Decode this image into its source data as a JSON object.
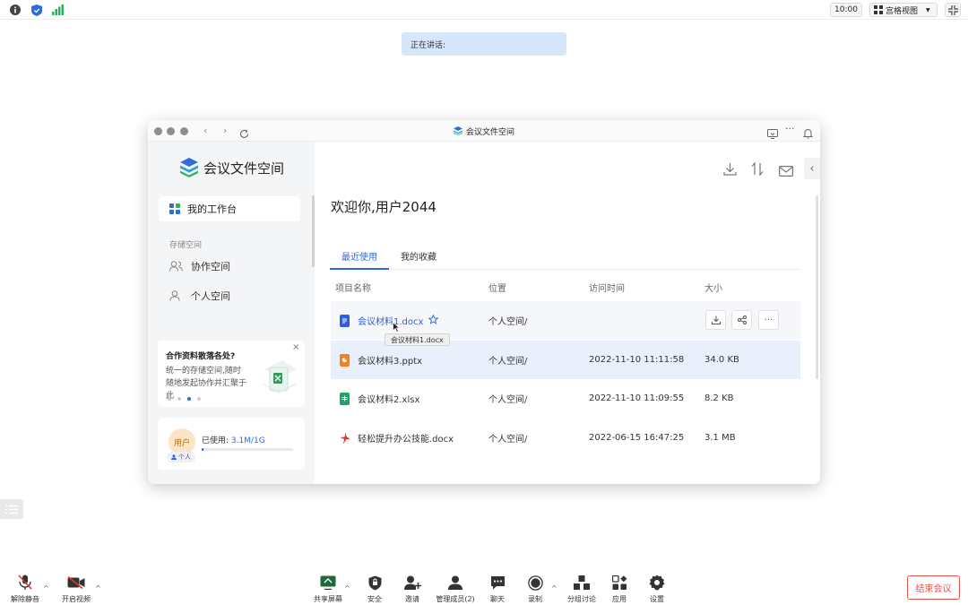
{
  "topbar": {
    "clock": "10:00",
    "view_label": "宫格视图"
  },
  "speaking_label": "正在讲话:",
  "window": {
    "title": "会议文件空间"
  },
  "sidebar": {
    "brand": "会议文件空间",
    "home": "我的工作台",
    "storage_label": "存储空间",
    "items": [
      {
        "label": "协作空间"
      },
      {
        "label": "个人空间"
      }
    ],
    "promo": {
      "title": "合作资料散落各处?",
      "text": "统一的存储空间,随时随地发起协作并汇聚于此",
      "close": "×"
    },
    "usage": {
      "avatar": "用户",
      "badge": "个人",
      "label": "已使用:",
      "value": "3.1M/1G",
      "fraction": 0.003
    }
  },
  "main": {
    "welcome": "欢迎你,用户2044",
    "tabs": [
      {
        "label": "最近使用"
      },
      {
        "label": "我的收藏"
      }
    ],
    "columns": {
      "name": "项目名称",
      "location": "位置",
      "time": "访问时间",
      "size": "大小"
    },
    "files": [
      {
        "name": "会议材料1.docx",
        "location": "个人空间/",
        "time": "",
        "size": "",
        "type": "doc",
        "color": "#2f5fde"
      },
      {
        "name": "会议材料3.pptx",
        "location": "个人空间/",
        "time": "2022-11-10 11:11:58",
        "size": "34.0 KB",
        "type": "ppt",
        "color": "#f0821d"
      },
      {
        "name": "会议材料2.xlsx",
        "location": "个人空间/",
        "time": "2022-11-10 11:09:55",
        "size": "8.2 KB",
        "type": "xls",
        "color": "#21a366"
      },
      {
        "name": "轻松提升办公技能.docx",
        "location": "个人空间/",
        "time": "2022-06-15 16:47:25",
        "size": "3.1 MB",
        "type": "pdf",
        "color": "#e0352b"
      }
    ],
    "tooltip": "会议材料1.docx"
  },
  "toolbar": {
    "mute": "解除静音",
    "video": "开启视频",
    "share": "共享屏幕",
    "security": "安全",
    "invite": "邀请",
    "members": "管理成员(2)",
    "chat": "聊天",
    "record": "录制",
    "breakout": "分组讨论",
    "apps": "应用",
    "settings": "设置",
    "end": "结束会议"
  }
}
